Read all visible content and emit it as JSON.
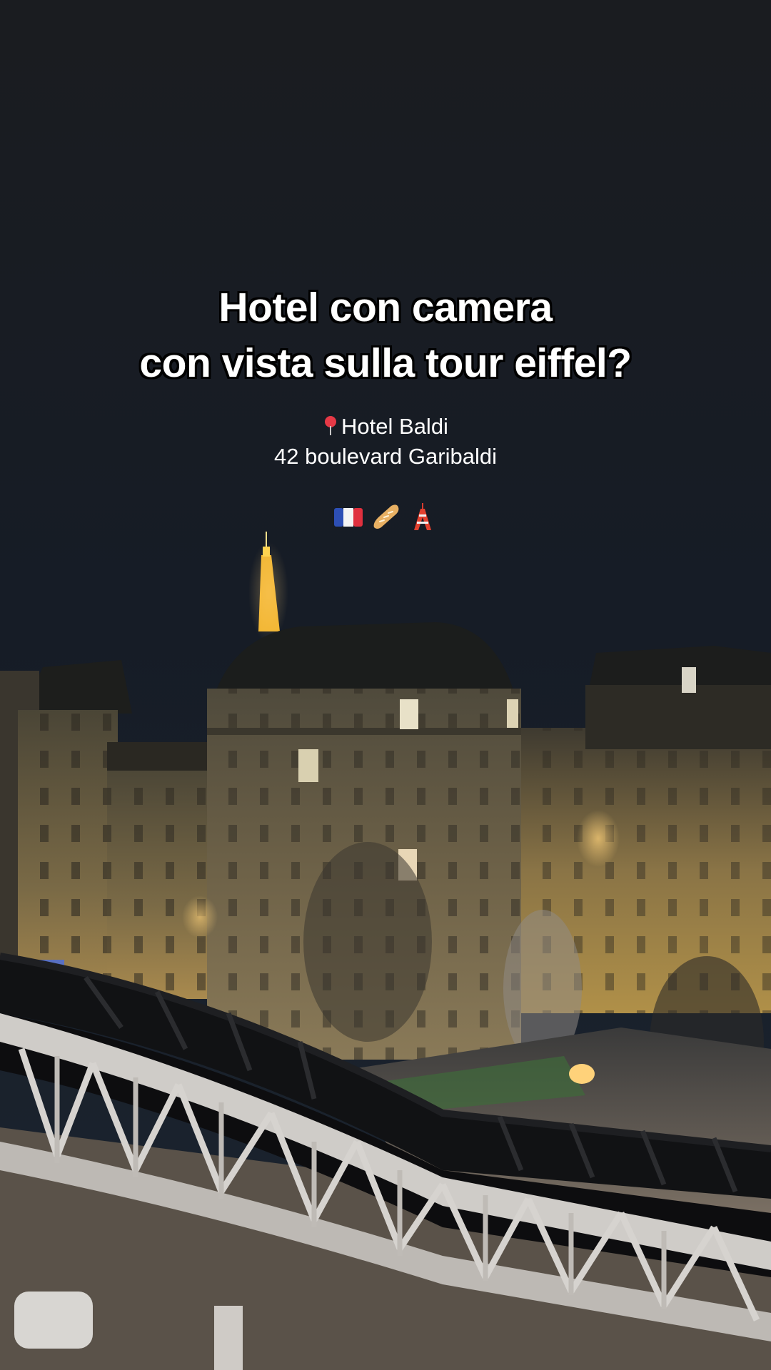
{
  "caption": {
    "line1": "Hotel con camera",
    "line2": "con vista sulla tour eiffel?"
  },
  "location": {
    "pin_icon": "round-pushpin-icon",
    "hotel_name": "Hotel Baldi",
    "address": "42 boulevard Garibaldi"
  },
  "emojis": [
    "france-flag-icon",
    "baguette-icon",
    "tokyo-tower-icon"
  ],
  "colors": {
    "sky": "#161a20",
    "tower_light": "#f2b632",
    "building_light": "#c9a45e",
    "bridge": "#c9c6c2"
  }
}
